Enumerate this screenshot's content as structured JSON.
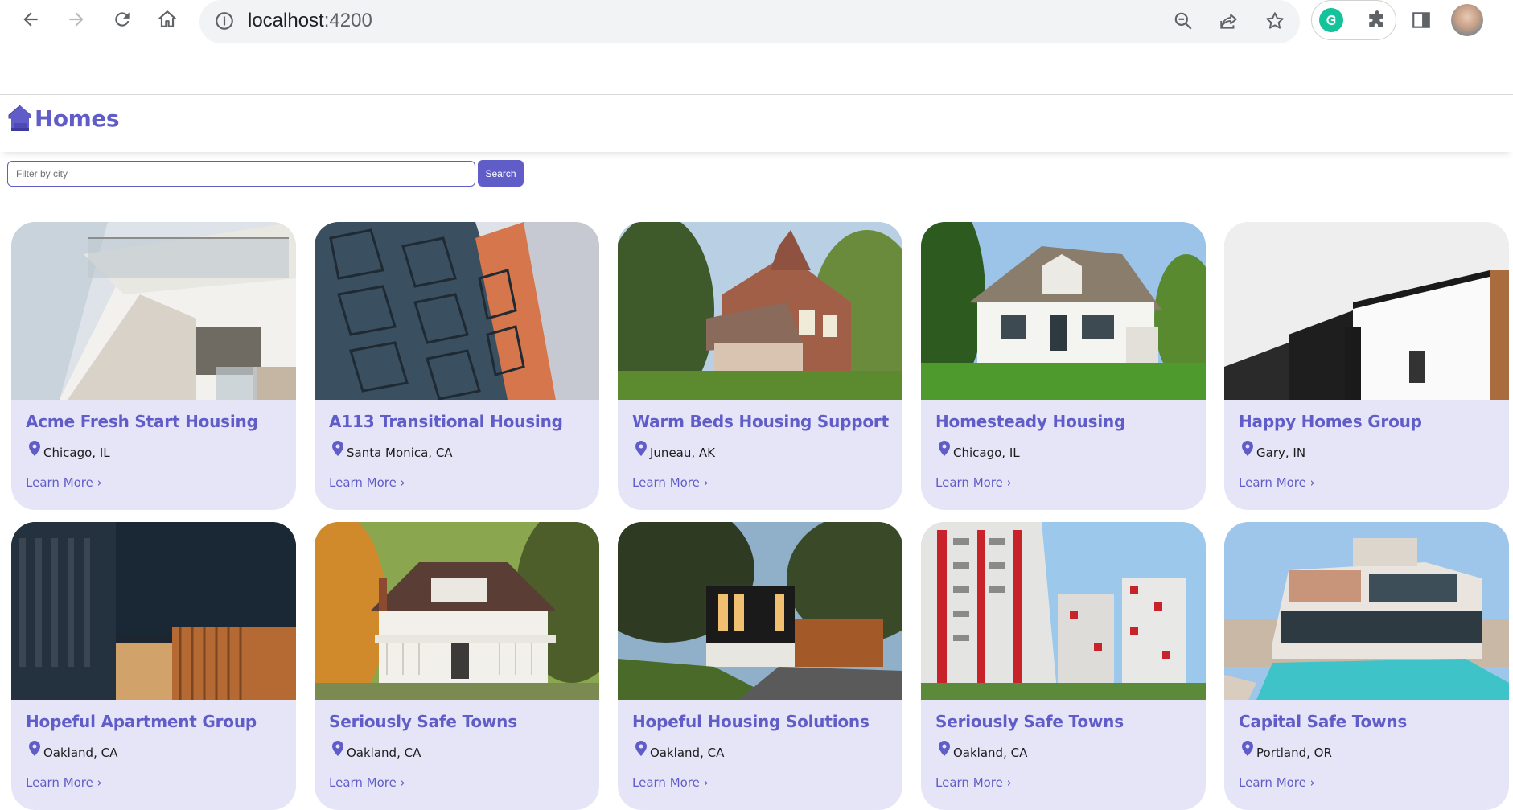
{
  "browser": {
    "url_host": "localhost",
    "url_port": ":4200"
  },
  "app": {
    "title": "Homes",
    "brand_color": "#605dc8",
    "card_bg": "#e6e5f8"
  },
  "search": {
    "placeholder": "Filter by city",
    "button_label": "Search"
  },
  "listings": [
    {
      "name": "Acme Fresh Start Housing",
      "location": "Chicago, IL",
      "link_label": "Learn More ›",
      "photo": "modern-white-balconies"
    },
    {
      "name": "A113 Transitional Housing",
      "location": "Santa Monica, CA",
      "link_label": "Learn More ›",
      "photo": "blue-apartment-balconies"
    },
    {
      "name": "Warm Beds Housing Support",
      "location": "Juneau, AK",
      "link_label": "Learn More ›",
      "photo": "victorian-brick-house"
    },
    {
      "name": "Homesteady Housing",
      "location": "Chicago, IL",
      "link_label": "Learn More ›",
      "photo": "white-cottage"
    },
    {
      "name": "Happy Homes Group",
      "location": "Gary, IN",
      "link_label": "Learn More ›",
      "photo": "minimal-white-black-house"
    },
    {
      "name": "Hopeful Apartment Group",
      "location": "Oakland, CA",
      "link_label": "Learn More ›",
      "photo": "dark-modern-building"
    },
    {
      "name": "Seriously Safe Towns",
      "location": "Oakland, CA",
      "link_label": "Learn More ›",
      "photo": "porch-house-autumn"
    },
    {
      "name": "Hopeful Housing Solutions",
      "location": "Oakland, CA",
      "link_label": "Learn More ›",
      "photo": "modern-house-dusk"
    },
    {
      "name": "Seriously Safe Towns",
      "location": "Oakland, CA",
      "link_label": "Learn More ›",
      "photo": "red-white-highrise"
    },
    {
      "name": "Capital Safe Towns",
      "location": "Portland, OR",
      "link_label": "Learn More ›",
      "photo": "villa-with-pool"
    }
  ]
}
